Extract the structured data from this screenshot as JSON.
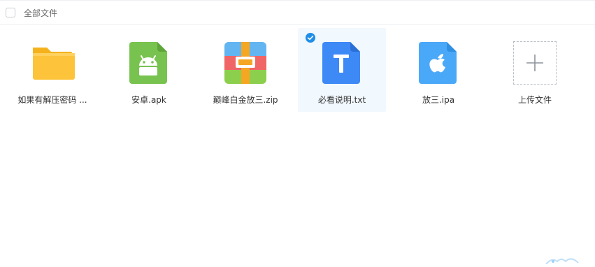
{
  "header": {
    "all_files_label": "全部文件"
  },
  "files": [
    {
      "name": "如果有解压密码 ...",
      "icon": "folder-icon",
      "selected": false
    },
    {
      "name": "安卓.apk",
      "icon": "android-apk-icon",
      "selected": false
    },
    {
      "name": "巅峰白金放三.zip",
      "icon": "zip-archive-icon",
      "selected": false
    },
    {
      "name": "必看说明.txt",
      "icon": "text-file-icon",
      "selected": true
    },
    {
      "name": "放三.ipa",
      "icon": "apple-ipa-icon",
      "selected": false
    }
  ],
  "upload": {
    "label": "上传文件",
    "icon": "plus-icon"
  },
  "colors": {
    "folder": "#fdc33a",
    "android": "#78c34f",
    "zip_red": "#f06565",
    "zip_green": "#8ccf4d",
    "zip_blue": "#63b5f2",
    "zip_orange": "#f5a623",
    "text_file": "#3d89f5",
    "apple": "#4aa8f8",
    "selected_bg": "#f1f8fe",
    "check": "#1f8ee8"
  }
}
